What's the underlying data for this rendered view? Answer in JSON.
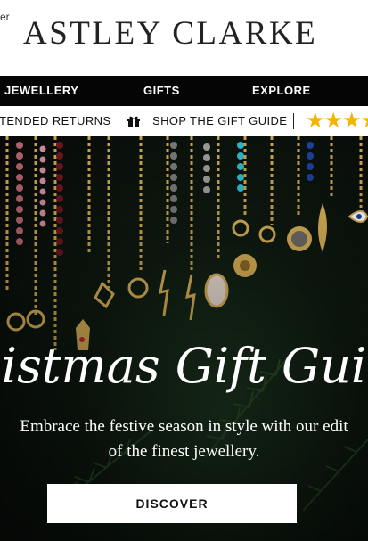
{
  "header": {
    "tiny_text": "er",
    "logo_text": "ASTLEY CLARKE"
  },
  "nav": {
    "items": [
      {
        "label": "JEWELLERY"
      },
      {
        "label": "GIFTS"
      },
      {
        "label": "EXPLORE"
      }
    ]
  },
  "promo": {
    "returns_text": "TENDED RETURNS",
    "gift_icon": "gift-icon",
    "gift_guide_text": "SHOP THE GIFT GUIDE",
    "stars_text": "★★★★"
  },
  "hero": {
    "headline": "istmas Gift Gui",
    "subtext_line1": "Embrace the festive season in style with our edit",
    "subtext_line2": "of the finest jewellery.",
    "cta_label": "DISCOVER"
  },
  "colors": {
    "nav_bg": "#050505",
    "star_color": "#f4b400",
    "hero_text": "#ffffff"
  }
}
